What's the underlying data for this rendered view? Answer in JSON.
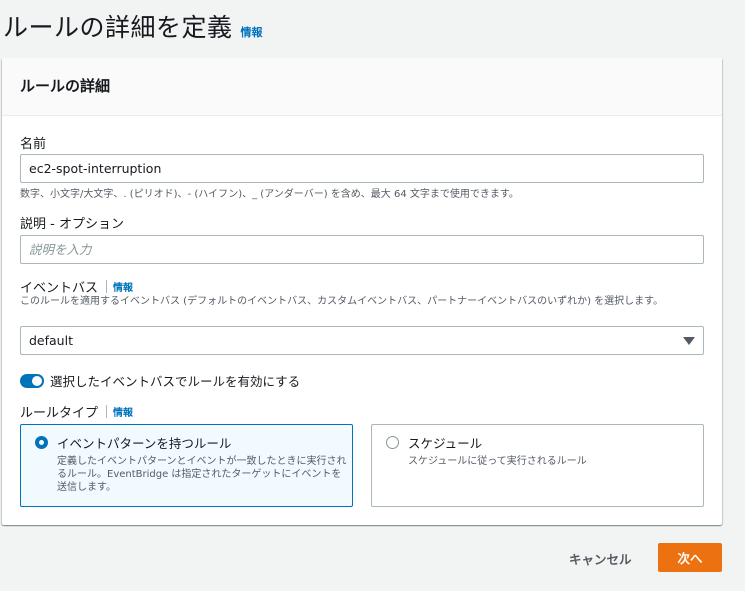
{
  "page": {
    "title": "ルールの詳細を定義",
    "info": "情報"
  },
  "panel": {
    "title": "ルールの詳細"
  },
  "name_field": {
    "label": "名前",
    "value": "ec2-spot-interruption",
    "hint": "数字、小文字/大文字、. (ピリオド)、- (ハイフン)、_ (アンダーバー) を含め、最大 64 文字まで使用できます。"
  },
  "description_field": {
    "label": "説明 - オプション",
    "placeholder": "説明を入力"
  },
  "event_bus": {
    "label": "イベントバス",
    "info": "情報",
    "hint": "このルールを適用するイベントバス (デフォルトのイベントバス、カスタムイベントバス、パートナーイベントバスのいずれか) を選択します。",
    "selected": "default"
  },
  "toggle": {
    "label": "選択したイベントバスでルールを有効にする",
    "enabled": true
  },
  "rule_type": {
    "label": "ルールタイプ",
    "info": "情報",
    "options": [
      {
        "title": "イベントパターンを持つルール",
        "description": "定義したイベントパターンとイベントが一致したときに実行されるルール。EventBridge は指定されたターゲットにイベントを送信します。",
        "selected": true
      },
      {
        "title": "スケジュール",
        "description": "スケジュールに従って実行されるルール",
        "selected": false
      }
    ]
  },
  "footer": {
    "cancel_label": "キャンセル",
    "next_label": "次へ"
  },
  "colors": {
    "accent": "#0073bb",
    "primary_button": "#ec7211"
  }
}
